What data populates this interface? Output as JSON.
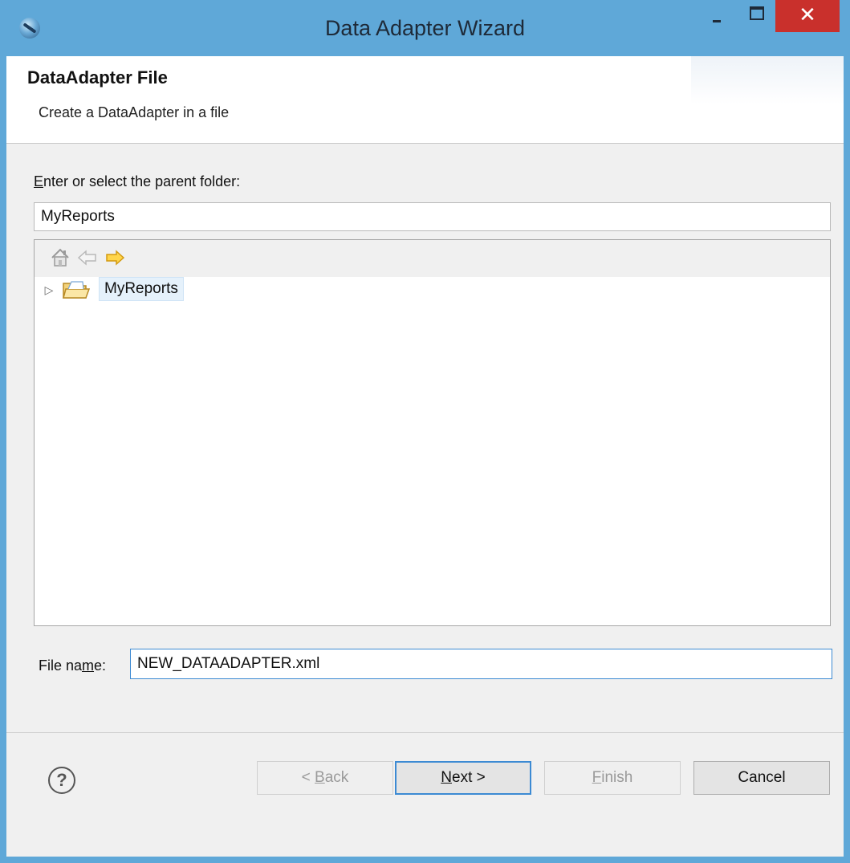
{
  "window": {
    "title": "Data Adapter Wizard",
    "close_glyph": "✕",
    "accent_color": "#5fa8d8",
    "close_color": "#c9302c"
  },
  "header": {
    "title": "DataAdapter File",
    "description": "Create a DataAdapter in a file"
  },
  "folder": {
    "label_access_key": "E",
    "label_rest": "nter or select the parent folder:",
    "value": "MyReports"
  },
  "tree": {
    "toolbar_icons": [
      "home-icon",
      "back-arrow-icon",
      "forward-arrow-icon"
    ],
    "items": [
      {
        "label": "MyReports",
        "expander": "▷",
        "icon": "open-folder-icon",
        "selected": true
      }
    ]
  },
  "file_name": {
    "label_before": "File na",
    "label_access_key": "m",
    "label_after": "e:",
    "value": "NEW_DATAADAPTER.xml"
  },
  "footer": {
    "help_glyph": "?",
    "back": {
      "prefix": "< ",
      "access_key": "B",
      "rest": "ack",
      "enabled": false
    },
    "next": {
      "access_key": "N",
      "rest": "ext >",
      "enabled": true
    },
    "finish": {
      "access_key": "F",
      "rest": "inish",
      "enabled": false
    },
    "cancel": {
      "label": "Cancel",
      "enabled": true
    }
  }
}
